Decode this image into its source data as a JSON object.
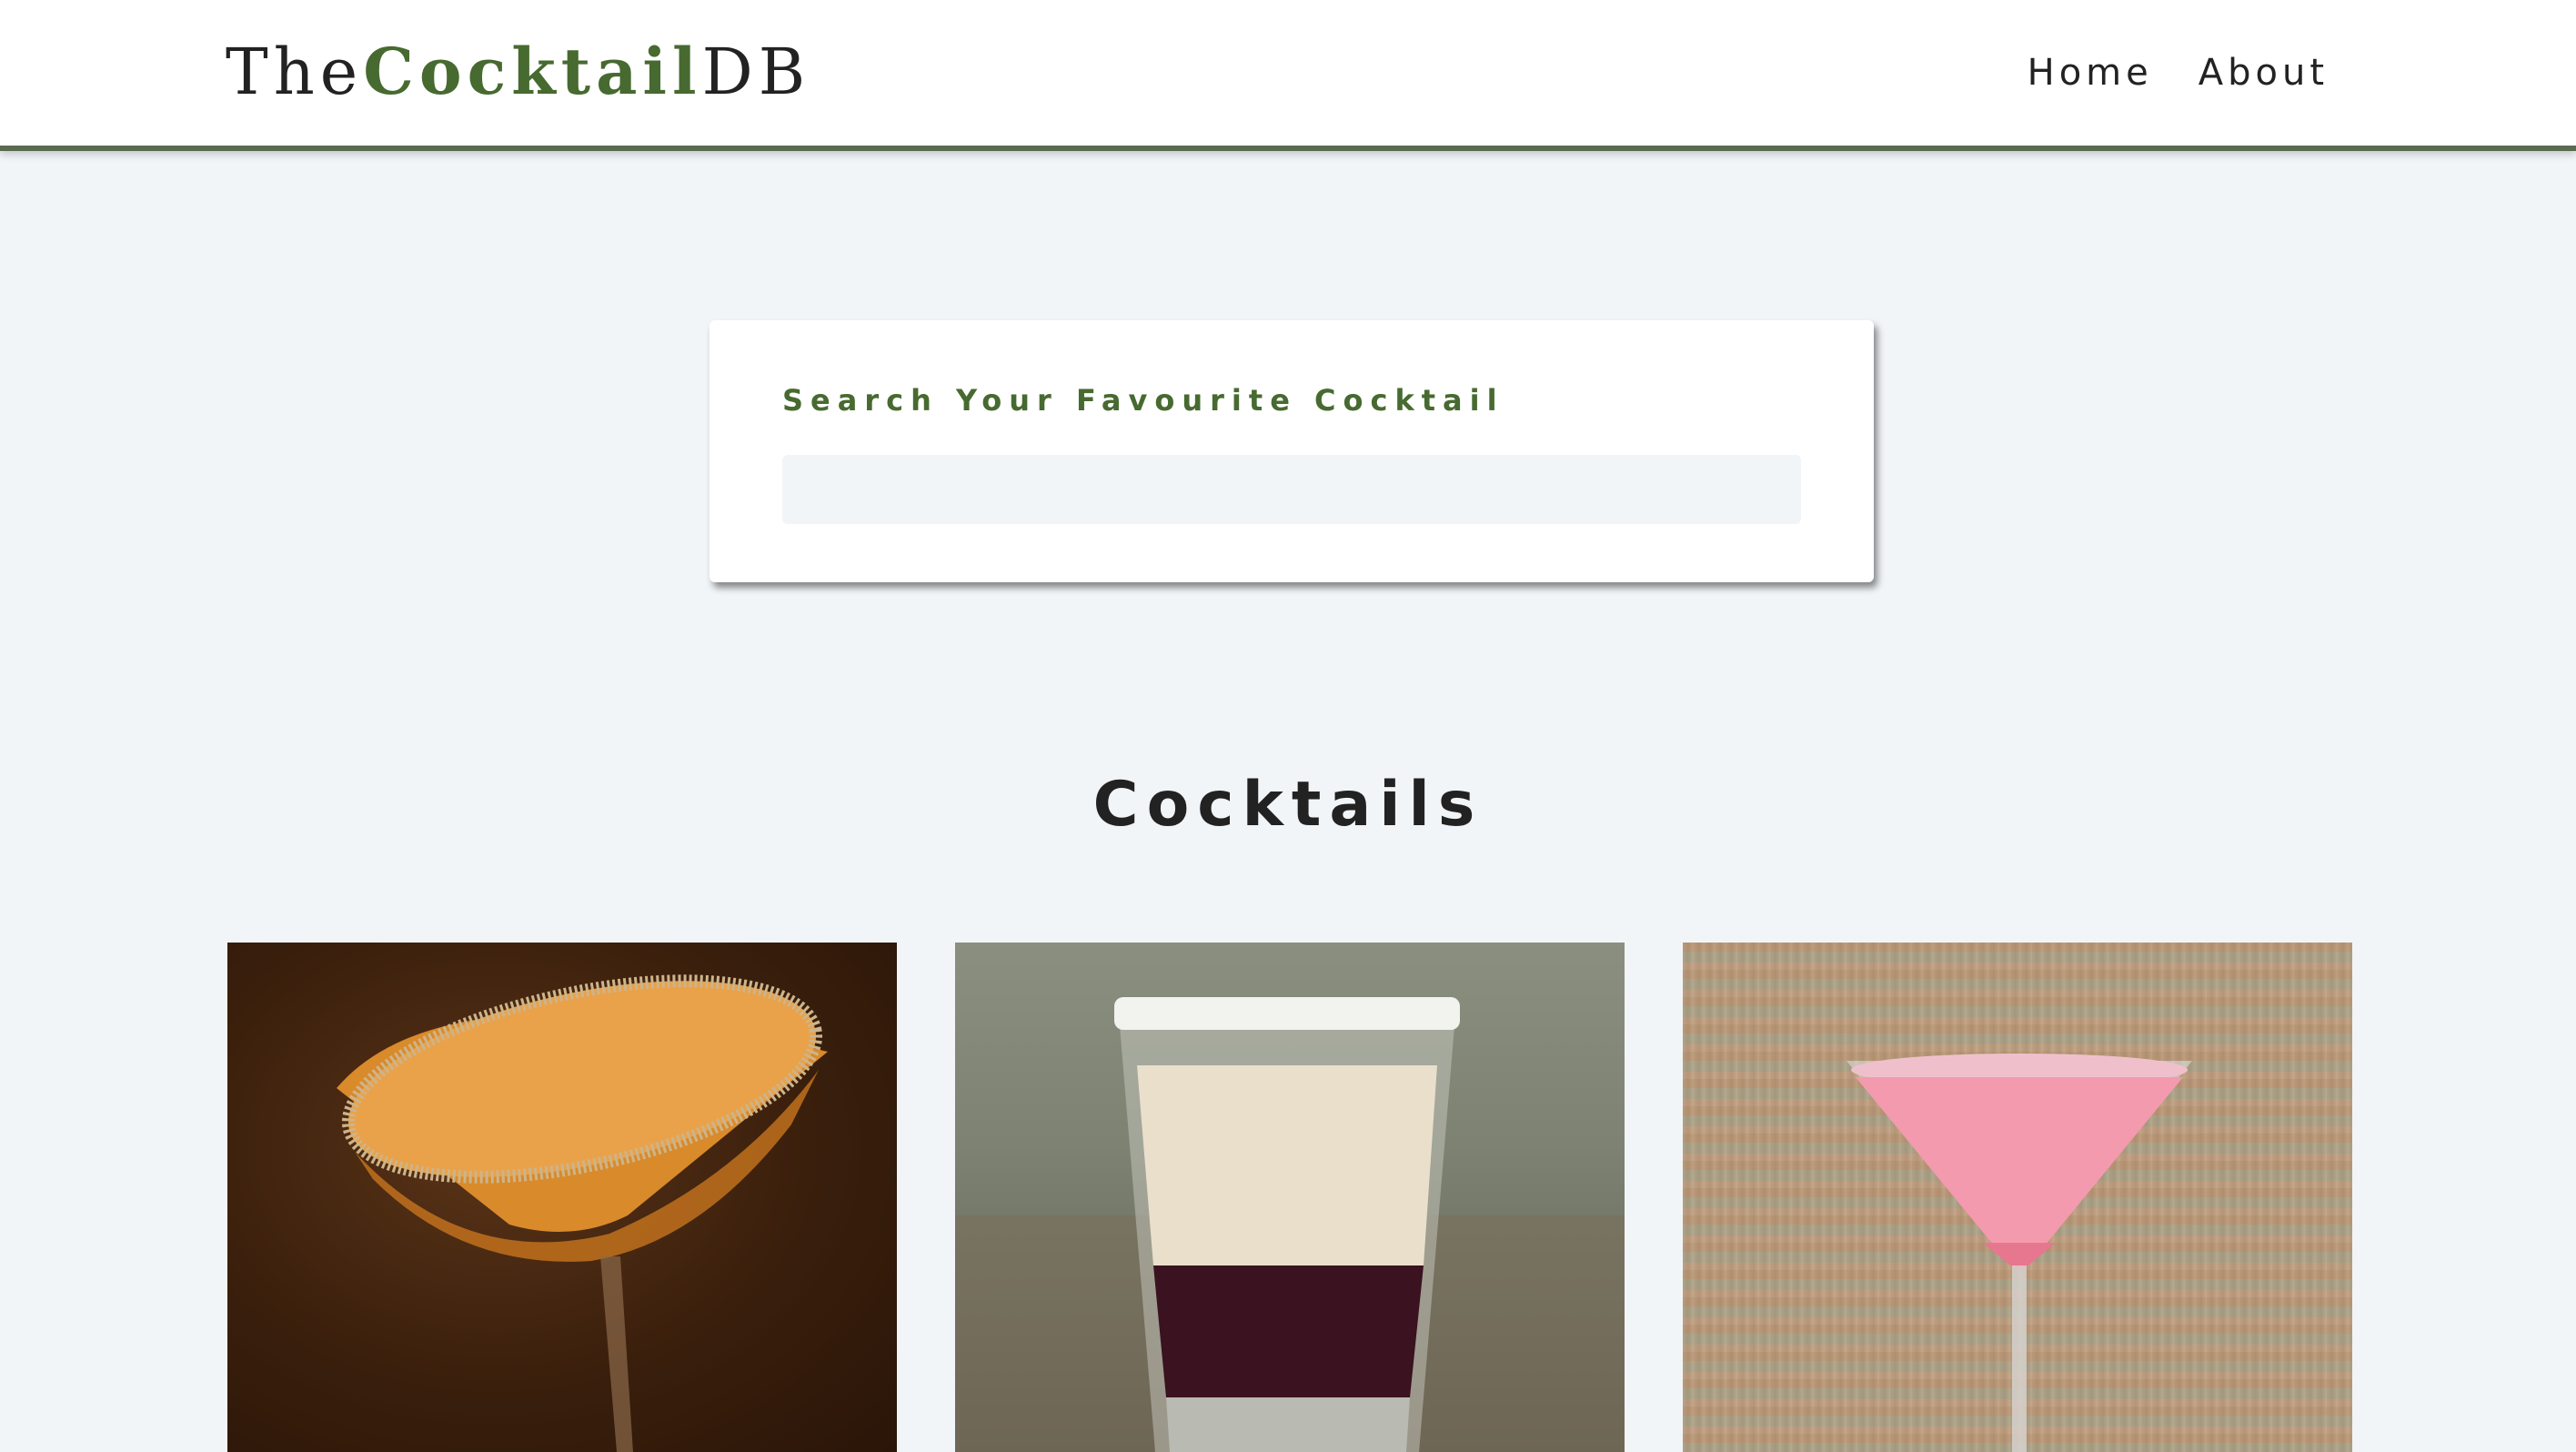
{
  "navbar": {
    "logo_prefix": "The",
    "logo_accent": "Cocktail",
    "logo_suffix": "DB",
    "links": [
      {
        "label": "Home"
      },
      {
        "label": "About"
      }
    ]
  },
  "search": {
    "label": "Search Your Favourite Cocktail",
    "value": "",
    "placeholder": ""
  },
  "section": {
    "title": "Cocktails"
  },
  "cocktails": [
    {
      "image": "amber-martini-sugar-rim"
    },
    {
      "image": "layered-shot-salt-rim"
    },
    {
      "image": "pink-martini"
    }
  ],
  "colors": {
    "accent": "#476a30",
    "background": "#f1f5f8",
    "text": "#222222",
    "navbar_border": "#5b6b4f"
  }
}
